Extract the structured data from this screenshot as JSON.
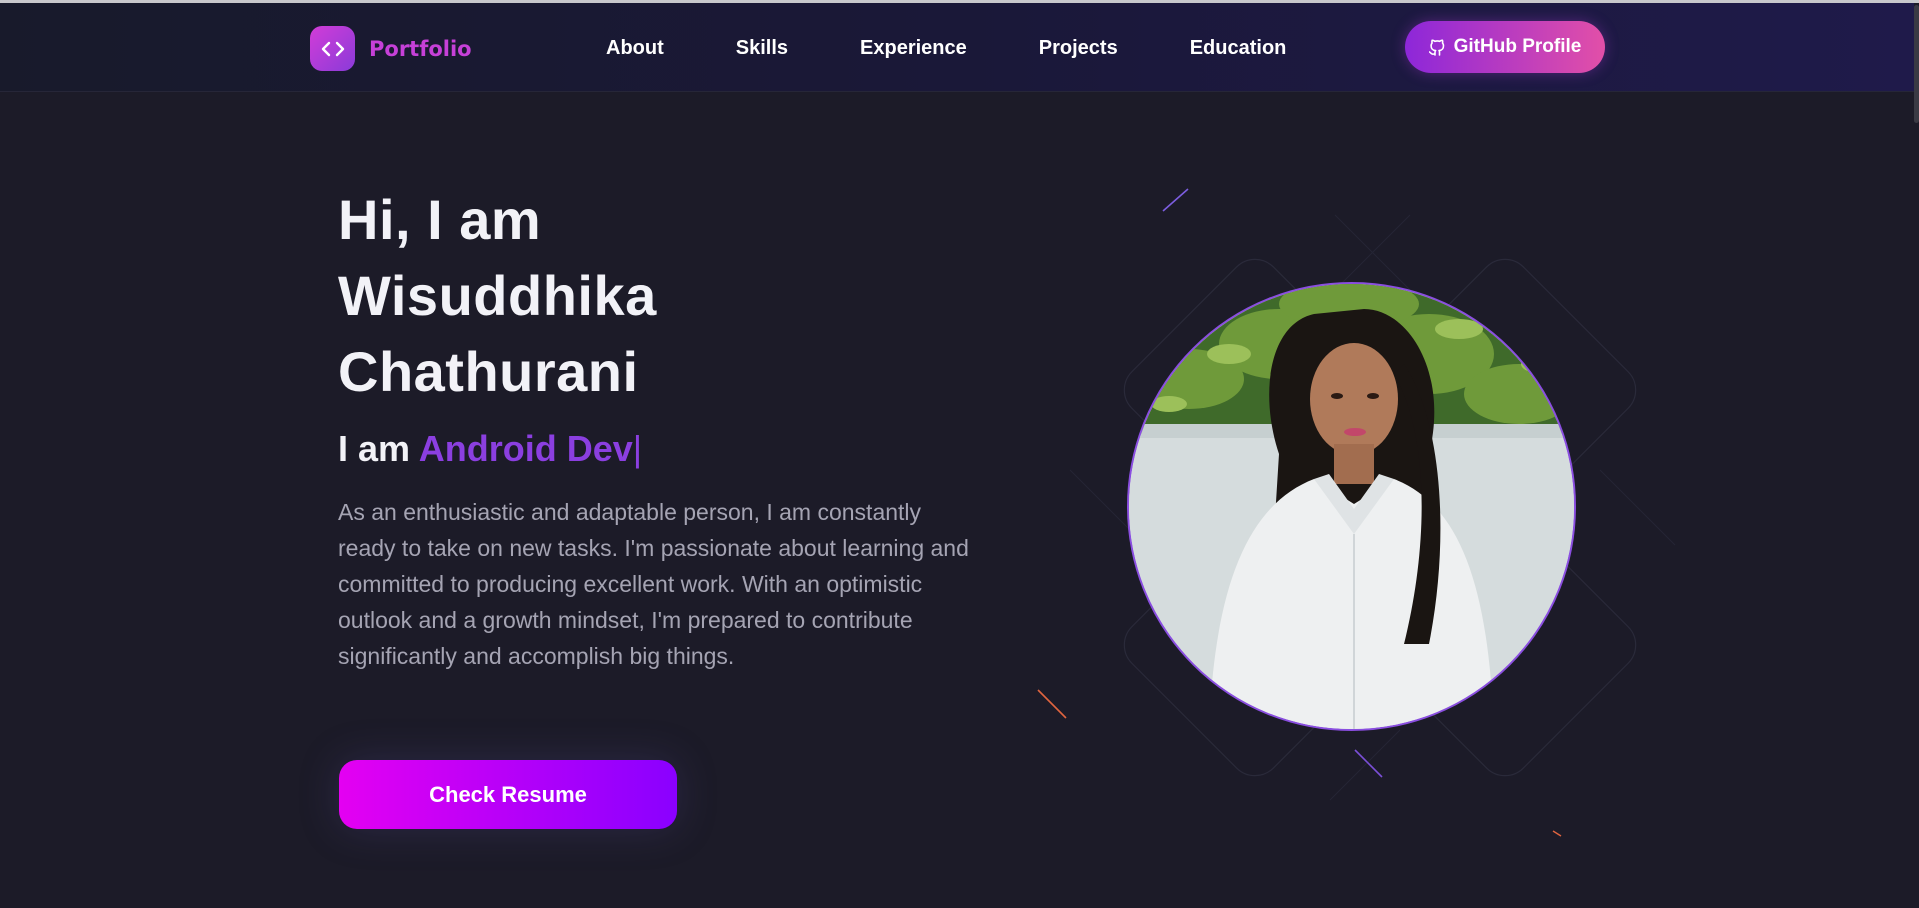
{
  "brand": {
    "label": "Portfolio",
    "icon": "code-icon"
  },
  "nav": {
    "links": [
      "About",
      "Skills",
      "Experience",
      "Projects",
      "Education"
    ],
    "github_label": "GitHub Profile",
    "github_icon": "github-icon"
  },
  "hero": {
    "title_line1": "Hi, I am",
    "title_line2": "Wisuddhika",
    "title_line3": "Chathurani",
    "sub_prefix": "I am",
    "sub_role": "Android Dev",
    "sub_caret": "|",
    "description": "As an enthusiastic and adaptable person, I am constantly ready to take on new tasks. I'm passionate about learning and committed to producing excellent work. With an optimistic outlook and a growth mindset, I'm prepared to contribute significantly and accomplish big things.",
    "resume_label": "Check Resume"
  },
  "profile": {
    "image": "profile-photo"
  },
  "colors": {
    "background": "#1c1b28",
    "accent_purple": "#8b3fe0",
    "brand_pink": "#c640d8",
    "button_gradient_start": "#e400f2",
    "button_gradient_end": "#8a00ff"
  }
}
